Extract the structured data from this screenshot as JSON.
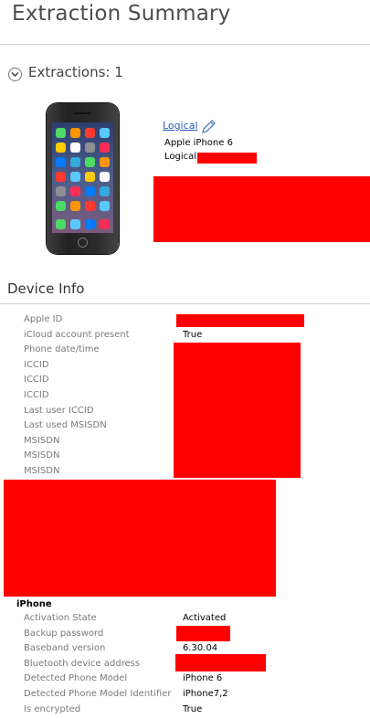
{
  "header": {
    "title": "Extraction Summary"
  },
  "extractions": {
    "heading": "Extractions: 1",
    "link_label": "Logical",
    "device_name": "Apple iPhone 6",
    "type_label": "Logical"
  },
  "device_info": {
    "heading": "Device Info",
    "rows": [
      {
        "label": "Apple ID",
        "value": ""
      },
      {
        "label": "iCloud account present",
        "value": "True"
      },
      {
        "label": "Phone date/time",
        "value": ""
      },
      {
        "label": "ICCID",
        "value": ""
      },
      {
        "label": "ICCID",
        "value": ""
      },
      {
        "label": "ICCID",
        "value": ""
      },
      {
        "label": "Last user ICCID",
        "value": ""
      },
      {
        "label": "Last used MSISDN",
        "value": ""
      },
      {
        "label": "MSISDN",
        "value": ""
      },
      {
        "label": "MSISDN",
        "value": ""
      },
      {
        "label": "MSISDN",
        "value": ""
      }
    ]
  },
  "iphone": {
    "heading": "iPhone",
    "rows": [
      {
        "label": "Activation State",
        "value": "Activated"
      },
      {
        "label": "Backup password",
        "value": ""
      },
      {
        "label": "Baseband version",
        "value": "6.30.04"
      },
      {
        "label": "Bluetooth device address",
        "value": ""
      },
      {
        "label": "Detected Phone Model",
        "value": "iPhone 6"
      },
      {
        "label": "Detected Phone Model Identifier",
        "value": "iPhone7,2"
      },
      {
        "label": "Is encrypted",
        "value": "True"
      }
    ]
  },
  "colors": {
    "redaction": "#ff0000",
    "link": "#2a5ab3",
    "label": "#7a7a7a"
  },
  "icons": {
    "expander": "chevron-down-circle-icon",
    "edit": "pencil-icon"
  }
}
